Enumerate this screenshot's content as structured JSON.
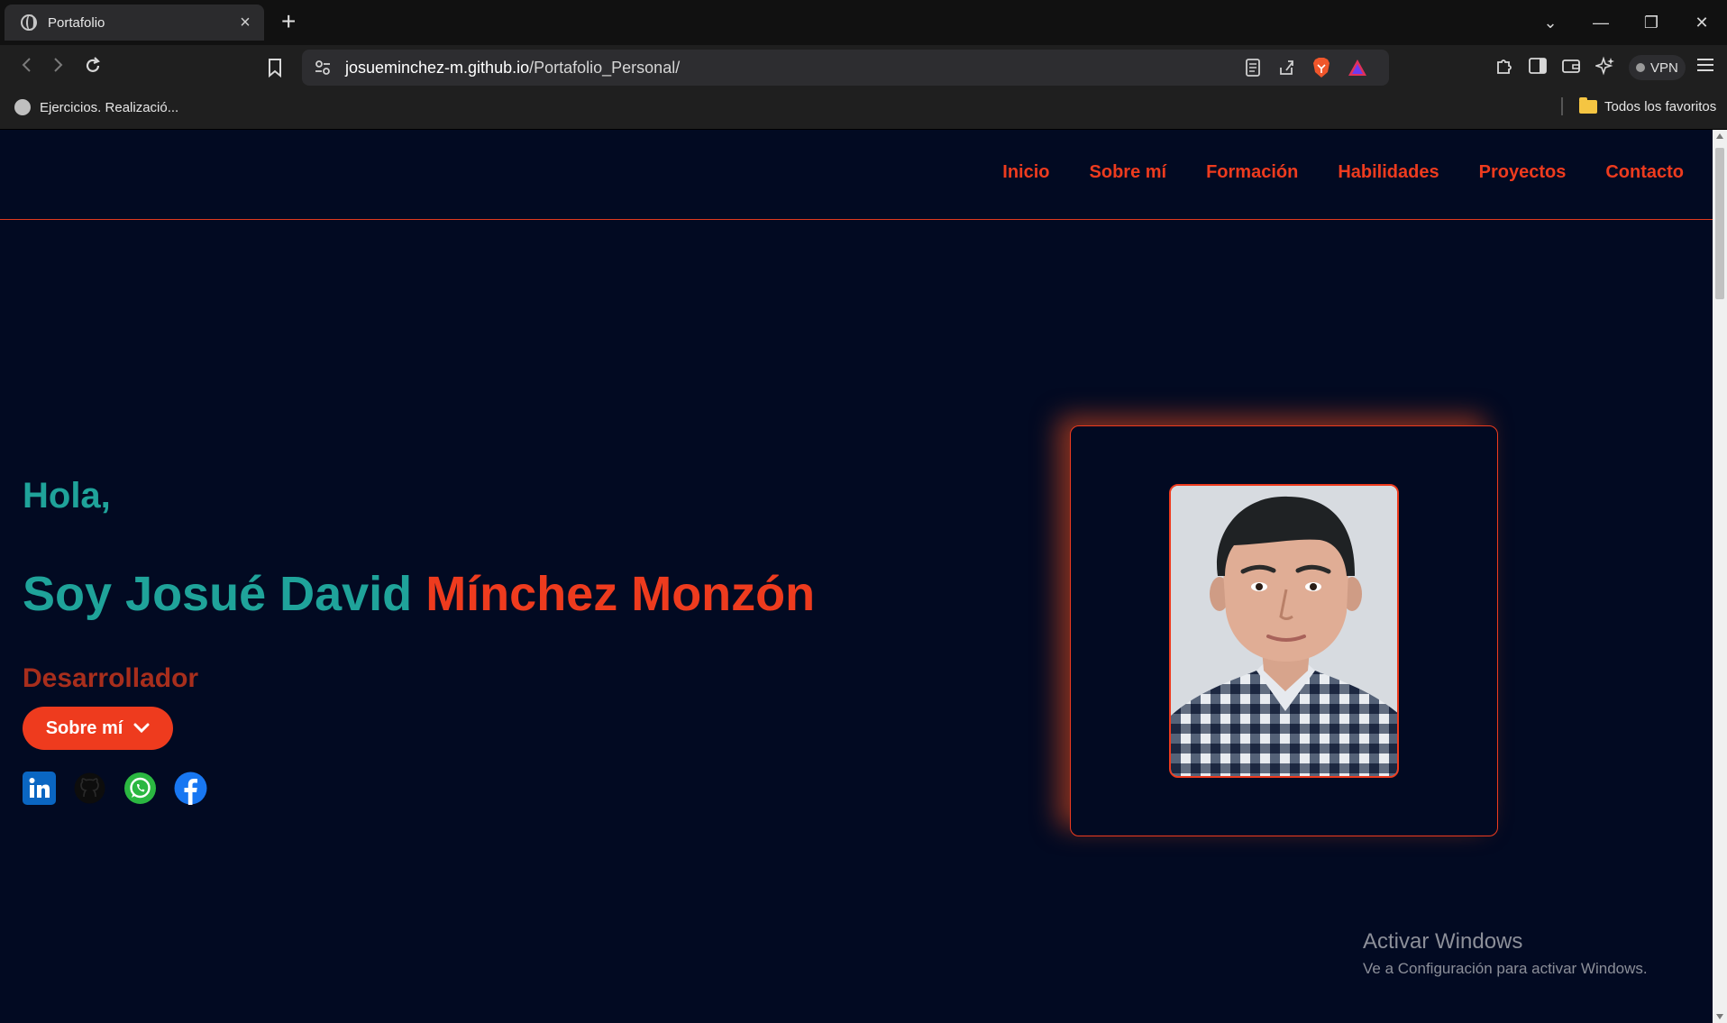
{
  "browser": {
    "tab_title": "Portafolio",
    "tab_close": "×",
    "new_tab": "+",
    "url_host": "josueminchez-m.github.io",
    "url_path": "/Portafolio_Personal/",
    "vpn_label": "VPN",
    "window_controls": [
      "⌄",
      "—",
      "❐",
      "✕"
    ],
    "bookmarks": [
      {
        "label": "Ejercicios. Realizació..."
      }
    ],
    "all_bookmarks_label": "Todos los favoritos"
  },
  "site": {
    "nav": [
      "Inicio",
      "Sobre mí",
      "Formación",
      "Habilidades",
      "Proyectos",
      "Contacto"
    ],
    "greeting": "Hola,",
    "name_first": "Soy Josué David",
    "name_last": "Mínchez Monzón",
    "role": "Desarrollador",
    "about_button": "Sobre mí",
    "socials": [
      "linkedin-icon",
      "github-icon",
      "whatsapp-icon",
      "facebook-icon"
    ]
  },
  "os_watermark": {
    "title": "Activar Windows",
    "subtitle": "Ve a Configuración para activar Windows."
  },
  "colors": {
    "page_bg": "#020a22",
    "accent_orange": "#ee3b1e",
    "teal": "#1fa39a",
    "role_red": "#a82e1c"
  }
}
